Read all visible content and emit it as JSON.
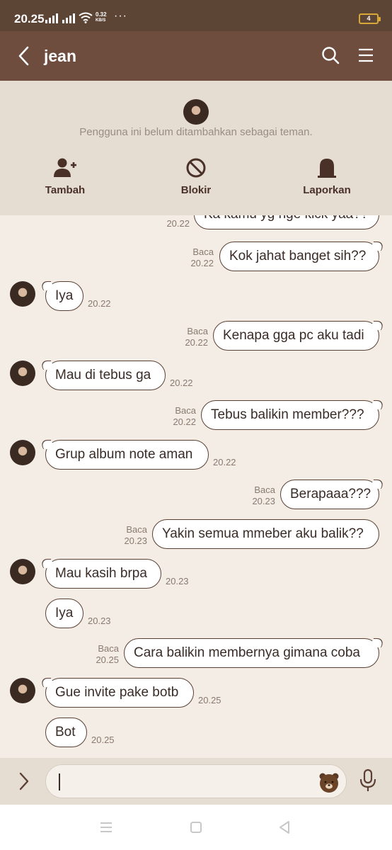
{
  "status_bar": {
    "time": "20.25",
    "network_speed_value": "0.32",
    "network_speed_unit": "KB/S",
    "more": "···",
    "battery": "4",
    "icons": [
      "signal-icon",
      "signal-icon",
      "wifi-icon",
      "battery-icon"
    ]
  },
  "header": {
    "title": "jean",
    "icons": [
      "back-arrow-icon",
      "search-icon",
      "menu-icon"
    ]
  },
  "friend_notice": {
    "message": "Pengguna ini belum ditambahkan sebagai teman.",
    "actions": [
      {
        "label": "Tambah",
        "icon": "add-user-icon"
      },
      {
        "label": "Blokir",
        "icon": "block-icon"
      },
      {
        "label": "Laporkan",
        "icon": "report-icon"
      }
    ]
  },
  "messages": [
    {
      "side": "right",
      "text": "Ka kamu yg nge kick yaa??",
      "read": "",
      "time": "20.22"
    },
    {
      "side": "right",
      "text": "Kok jahat banget sih??",
      "read": "Baca",
      "time": "20.22"
    },
    {
      "side": "left",
      "text": "Iya",
      "time": "20.22"
    },
    {
      "side": "right",
      "text": "Kenapa gga pc aku tadi",
      "read": "Baca",
      "time": "20.22"
    },
    {
      "side": "left",
      "text": "Mau di tebus ga",
      "time": "20.22"
    },
    {
      "side": "right",
      "text": "Tebus balikin member???",
      "read": "Baca",
      "time": "20.22"
    },
    {
      "side": "left",
      "text": "Grup album note aman",
      "time": "20.22"
    },
    {
      "side": "right",
      "text": "Berapaaa???",
      "read": "Baca",
      "time": "20.23"
    },
    {
      "side": "right",
      "text": "Yakin semua mmeber aku balik??",
      "read": "Baca",
      "time": "20.23"
    },
    {
      "side": "left",
      "text": "Mau kasih brpa",
      "time": "20.23"
    },
    {
      "side": "left",
      "text": "Iya",
      "time": "20.23"
    },
    {
      "side": "right",
      "text": "Cara balikin membernya gimana coba",
      "read": "Baca",
      "time": "20.25"
    },
    {
      "side": "left",
      "text": "Gue invite pake botb",
      "time": "20.25"
    },
    {
      "side": "left",
      "text": "Bot",
      "time": "20.25"
    }
  ],
  "input_bar": {
    "value": "",
    "icons": [
      "chevron-right-icon",
      "sticker-icon",
      "microphone-icon"
    ]
  },
  "nav_bar": {
    "icons": [
      "recent-apps-icon",
      "home-icon",
      "back-icon"
    ]
  },
  "colors": {
    "status_bar": "#5d4536",
    "header": "#6e4d3e",
    "panel": "#e5dcd2",
    "chat_bg": "#f3ede6",
    "bubble_border": "#5a4033"
  }
}
